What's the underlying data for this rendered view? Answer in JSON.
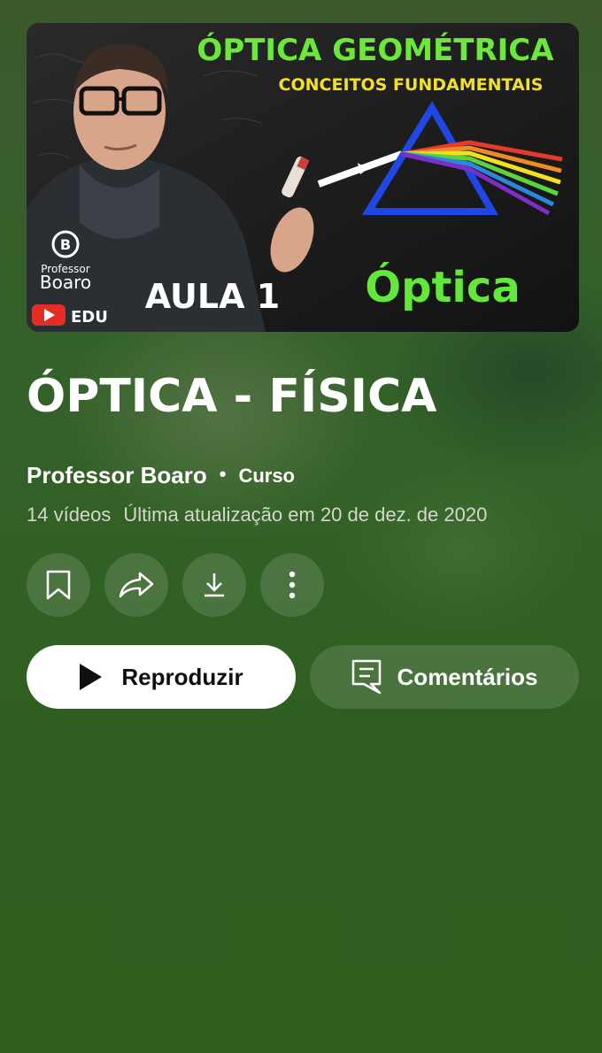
{
  "thumbnail": {
    "heading": "ÓPTICA GEOMÉTRICA",
    "subheading": "CONCEITOS FUNDAMENTAIS",
    "lesson": "AULA 1",
    "subject": "Óptica",
    "brand_line1": "Professor",
    "brand_line2": "Boaro",
    "badge": "EDU"
  },
  "playlist": {
    "title": "ÓPTICA - FÍSICA",
    "channel": "Professor Boaro",
    "separator": "•",
    "type": "Curso",
    "video_count": "14 vídeos",
    "updated": "Última atualização em 20 de dez. de 2020"
  },
  "actions": {
    "play_label": "Reproduzir",
    "comments_label": "Comentários"
  },
  "icons": [
    "bookmark-icon",
    "share-icon",
    "download-icon",
    "more-vert-icon",
    "play-icon",
    "comments-icon"
  ]
}
